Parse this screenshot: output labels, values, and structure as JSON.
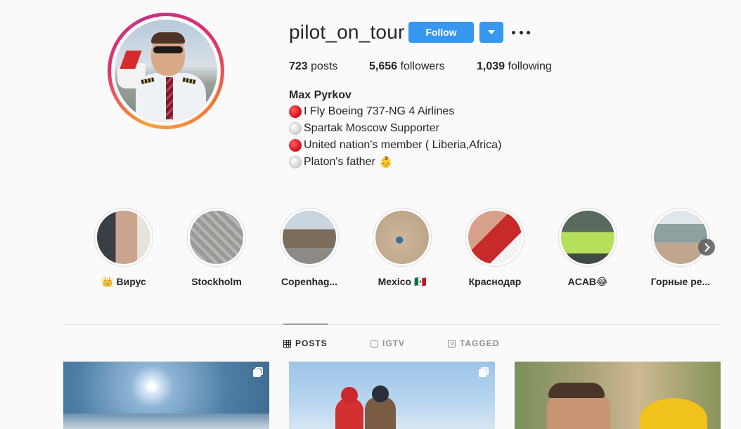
{
  "profile": {
    "username": "pilot_on_tour",
    "follow_label": "Follow",
    "posts_count": "723",
    "posts_label": "posts",
    "followers_count": "5,656",
    "followers_label": "followers",
    "following_count": "1,039",
    "following_label": "following",
    "full_name": "Max Pyrkov",
    "bio": [
      {
        "bullet": "red",
        "text": "I Fly Boeing 737-NG 4 Airlines"
      },
      {
        "bullet": "white",
        "text": "Spartak Moscow Supporter"
      },
      {
        "bullet": "red",
        "text": "United nation's member ( Liberia,Africa)"
      },
      {
        "bullet": "white",
        "text": "Platon's father",
        "emoji": "👶"
      }
    ]
  },
  "highlights": [
    {
      "label": "👑 Вирус"
    },
    {
      "label": "Stockholm"
    },
    {
      "label": "Copenhag..."
    },
    {
      "label": "Mexico 🇲🇽"
    },
    {
      "label": "Краснодар"
    },
    {
      "label": "ACAB😂"
    },
    {
      "label": "Горные ре..."
    }
  ],
  "tabs": [
    {
      "label": "POSTS",
      "icon": "grid-icon",
      "active": true
    },
    {
      "label": "IGTV",
      "icon": "igtv-icon",
      "active": false
    },
    {
      "label": "TAGGED",
      "icon": "tagged-icon",
      "active": false
    }
  ],
  "colors": {
    "follow_blue": "#3897f0",
    "background": "#fafafa",
    "text": "#262626",
    "muted": "#8e8e8e"
  }
}
